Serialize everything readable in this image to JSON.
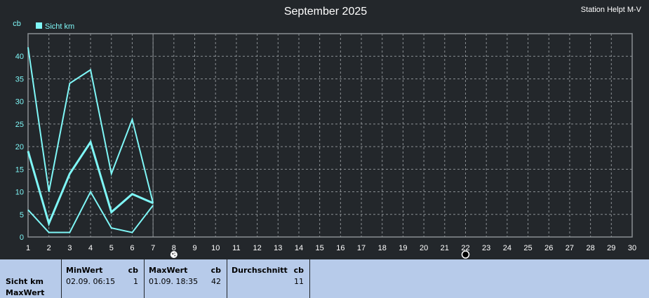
{
  "chart_data": {
    "type": "line",
    "title": "September 2025",
    "station": "Station Helpt M-V",
    "y_unit": "cb",
    "legend": [
      {
        "label": "Sicht km",
        "color": "#7ff7f7"
      }
    ],
    "legend_position": "top-left",
    "grid": true,
    "xlim": [
      1,
      30
    ],
    "ylim": [
      0,
      45
    ],
    "x_ticks": [
      "1",
      "2",
      "3",
      "4",
      "5",
      "6",
      "7",
      "8",
      "9",
      "10",
      "11",
      "12",
      "13",
      "14",
      "15",
      "16",
      "17",
      "18",
      "19",
      "20",
      "21",
      "22",
      "23",
      "24",
      "25",
      "26",
      "27",
      "28",
      "29",
      "30"
    ],
    "y_ticks": [
      "0",
      "5",
      "10",
      "15",
      "20",
      "25",
      "30",
      "35",
      "40"
    ],
    "current_day_marker": 7,
    "series": [
      {
        "name": "Sicht km",
        "role": "max",
        "x": [
          1,
          2,
          3,
          4,
          5,
          6,
          7
        ],
        "values": [
          42,
          10,
          34,
          37,
          14,
          26,
          7.5
        ],
        "width": 2,
        "color": "#7ff7f7"
      },
      {
        "name": "Sicht km",
        "role": "avg",
        "x": [
          1,
          2,
          3,
          4,
          5,
          6,
          7
        ],
        "values": [
          19,
          3,
          14,
          21,
          5.5,
          9.5,
          7.5
        ],
        "width": 3,
        "color": "#7ff7f7"
      },
      {
        "name": "Sicht km",
        "role": "min",
        "x": [
          1,
          2,
          3,
          4,
          5,
          6,
          7
        ],
        "values": [
          6,
          1,
          1,
          10,
          2,
          1,
          7
        ],
        "width": 2,
        "color": "#7ff7f7"
      }
    ],
    "symbols": [
      {
        "x": 8,
        "icon": "full-moon-icon"
      },
      {
        "x": 22,
        "icon": "new-moon-icon"
      }
    ]
  },
  "stats": {
    "row_label": "Sicht km",
    "row_sub": "MaxWert",
    "min": {
      "header": "MinWert",
      "unit": "cb",
      "date": "02.09.  06:15",
      "value": "1"
    },
    "max": {
      "header": "MaxWert",
      "unit": "cb",
      "date": "01.09.  18:35",
      "value": "42"
    },
    "avg": {
      "header": "Durchschnitt",
      "unit": "cb",
      "value": "11"
    }
  }
}
